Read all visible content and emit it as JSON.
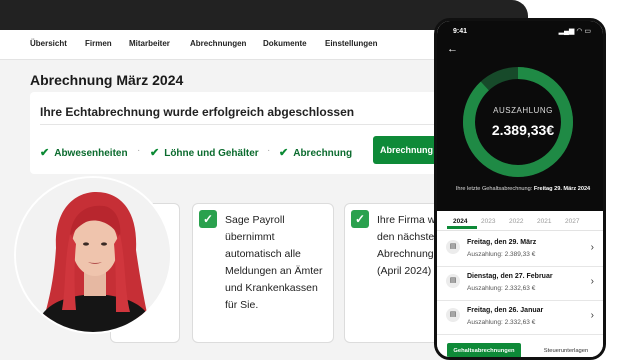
{
  "nav": {
    "items": [
      "Übersicht",
      "Firmen",
      "Mitarbeiter",
      "Abrechnungen",
      "Dokumente",
      "Einstellungen"
    ]
  },
  "page": {
    "title": "Abrechnung März 2024"
  },
  "status_card": {
    "headline": "Ihre Echtabrechnung wurde erfolgreich abgeschlossen",
    "checks": [
      "Abwesenheiten",
      "Löhne und Gehälter",
      "Abrechnung"
    ],
    "button_label": "Abrechnung abschließen"
  },
  "info_cards": [
    {
      "lines": [
        "Sage Payroll",
        "übernimmt",
        "automatisch alle",
        "Meldungen an Ämter",
        "und Krankenkassen",
        "für Sie."
      ]
    },
    {
      "lines": [
        "Ihre Firma wu",
        "den nächsten",
        "Abrechnungs",
        "(April 2024) g"
      ]
    }
  ],
  "phone": {
    "time": "9:41",
    "status_icons": "▂▄▆ ◠ ▭",
    "payout_label": "AUSZAHLUNG",
    "payout_amount": "2.389,33€",
    "last_calc_prefix": "Ihre letzte Gehaltsabrechnung:",
    "last_calc_date": "Freitag 29. März 2024",
    "years": [
      "2024",
      "2023",
      "2022",
      "2021",
      "2027"
    ],
    "active_year": "2024",
    "ring_progress": 0.88,
    "payments": [
      {
        "date": "Freitag, den 29. März",
        "amount": "Auszahlung: 2.389,33 €"
      },
      {
        "date": "Dienstag, den 27. Februar",
        "amount": "Auszahlung: 2.332,63 €"
      },
      {
        "date": "Freitag, den 26. Januar",
        "amount": "Auszahlung: 2.332,63 €"
      }
    ],
    "tabs": [
      "Gehaltsabrechnungen",
      "Steuerunterlagen"
    ]
  },
  "colors": {
    "brand_green": "#0e8a38",
    "ring_green": "#1f8a45",
    "ring_track": "#174a2a"
  }
}
